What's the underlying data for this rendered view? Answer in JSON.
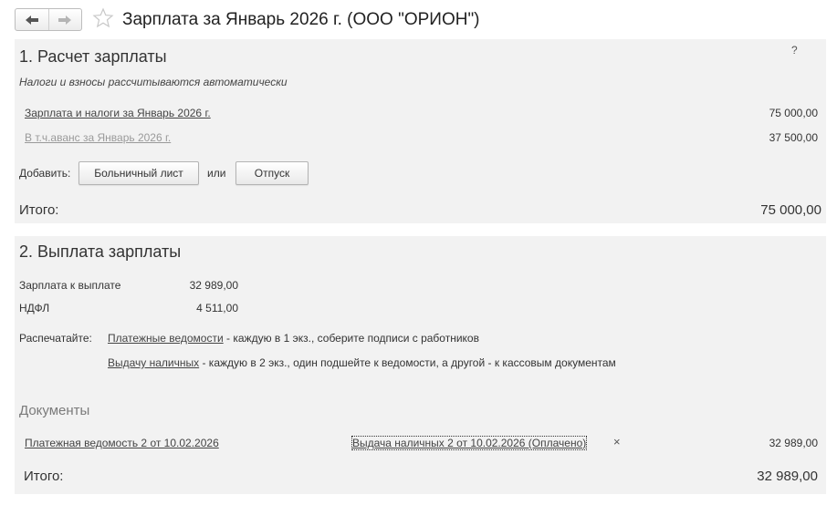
{
  "window": {
    "title": "Зарплата за Январь 2026 г. (ООО \"ОРИОН\")"
  },
  "icons": {
    "back": "arrow-left-icon",
    "forward": "arrow-right-icon",
    "favorite": "star-icon"
  },
  "section1": {
    "title": "1. Расчет зарплаты",
    "help": "?",
    "hint": "Налоги и взносы рассчитываются автоматически",
    "rows": [
      {
        "label": "Зарплата и налоги за Январь 2026 г.",
        "value": "75 000,00"
      },
      {
        "label": "В т.ч.аванс за Январь 2026 г.",
        "value": "37 500,00"
      }
    ],
    "add_label": "Добавить:",
    "sick_leave_button": "Больничный лист",
    "or_label": "или",
    "vacation_button": "Отпуск",
    "total_label": "Итого:",
    "total_value": "75 000,00"
  },
  "section2": {
    "title": "2. Выплата зарплаты",
    "rows": [
      {
        "label": "Зарплата к выплате",
        "value": "32 989,00"
      },
      {
        "label": "НДФЛ",
        "value": "4 511,00"
      }
    ],
    "print_label": "Распечатайте:",
    "print_items": [
      {
        "link": "Платежные ведомости",
        "text": " - каждую в 1 экз., соберите подписи с работников"
      },
      {
        "link": "Выдачу наличных",
        "text": " - каждую в 2 экз., один подшейте к ведомости, а другой - к кассовым документам"
      }
    ],
    "documents_heading": "Документы",
    "documents": [
      {
        "name": "Платежная ведомость 2 от 10.02.2026",
        "related": "Выдача наличных 2 от 10.02.2026 (Оплачено)",
        "remove": "×",
        "amount": "32 989,00"
      }
    ],
    "total_label": "Итого:",
    "total_value": "32 989,00"
  }
}
